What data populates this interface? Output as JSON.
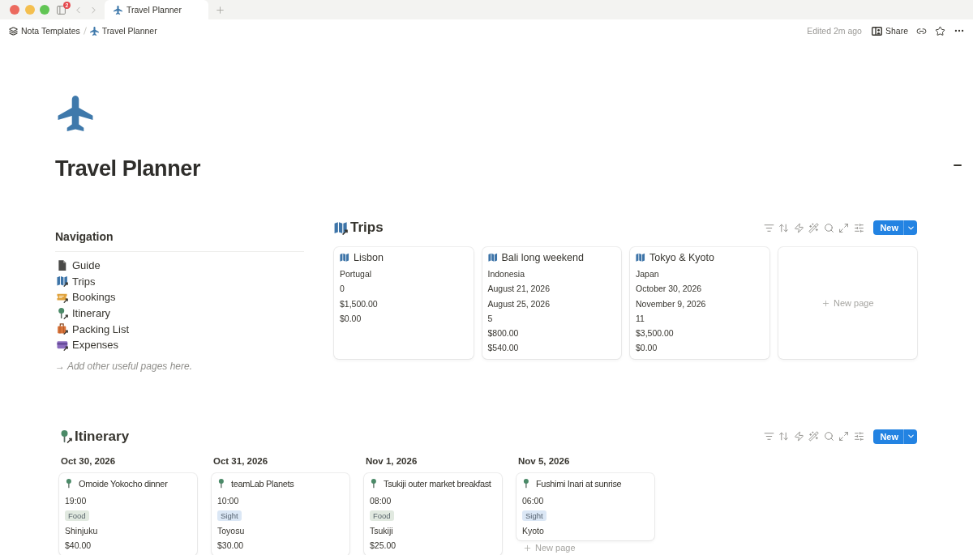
{
  "window": {
    "tabs": [
      {
        "title": "Travel Planner",
        "selected": true
      }
    ],
    "notification_count": "2"
  },
  "breadcrumb": [
    {
      "label": "Nota Templates",
      "kind": "workspace"
    },
    {
      "label": "Travel Planner",
      "kind": "page"
    }
  ],
  "page_header": {
    "edited": "Edited 2m ago",
    "share": "Share"
  },
  "page": {
    "title": "Travel Planner"
  },
  "navigation": {
    "heading": "Navigation",
    "items": [
      {
        "label": "Guide",
        "kind": "document",
        "linked": false
      },
      {
        "label": "Trips",
        "kind": "map",
        "linked": true
      },
      {
        "label": "Bookings",
        "kind": "ticket",
        "linked": true
      },
      {
        "label": "Itinerary",
        "kind": "pin",
        "linked": true
      },
      {
        "label": "Packing List",
        "kind": "luggage",
        "linked": true
      },
      {
        "label": "Expenses",
        "kind": "card",
        "linked": true
      }
    ],
    "hint": "→ Add other useful pages here."
  },
  "trips": {
    "title": "Trips",
    "new_button": "New",
    "cards": [
      {
        "title": "Lisbon",
        "properties": [
          "Portugal",
          "0",
          "$1,500.00",
          "$0.00"
        ]
      },
      {
        "title": "Bali long weekend",
        "properties": [
          "Indonesia",
          "August 21, 2026",
          "August 25, 2026",
          "5",
          "$800.00",
          "$540.00"
        ]
      },
      {
        "title": "Tokyo & Kyoto",
        "properties": [
          "Japan",
          "October 30, 2026",
          "November 9, 2026",
          "11",
          "$3,500.00",
          "$0.00"
        ]
      }
    ],
    "new_page": "New page"
  },
  "itinerary": {
    "title": "Itinerary",
    "new_button": "New",
    "groups": [
      {
        "date": "Oct 30, 2026",
        "cards": [
          {
            "title": "Omoide Yokocho dinner",
            "time": "19:00",
            "tag": {
              "label": "Food",
              "color": "#e1e9e0"
            },
            "location": "Shinjuku",
            "cost": "$40.00"
          }
        ]
      },
      {
        "date": "Oct 31, 2026",
        "cards": [
          {
            "title": "teamLab Planets",
            "time": "10:00",
            "tag": {
              "label": "Sight",
              "color": "#dbe7f5"
            },
            "location": "Toyosu",
            "cost": "$30.00"
          }
        ]
      },
      {
        "date": "Nov 1, 2026",
        "cards": [
          {
            "title": "Tsukiji outer market breakfast",
            "time": "08:00",
            "tag": {
              "label": "Food",
              "color": "#e1e9e0"
            },
            "location": "Tsukiji",
            "cost": "$25.00"
          }
        ]
      },
      {
        "date": "Nov 5, 2026",
        "cards": [
          {
            "title": "Fushimi Inari at sunrise",
            "time": "06:00",
            "tag": {
              "label": "Sight",
              "color": "#dbe7f5"
            },
            "location": "Kyoto"
          }
        ],
        "new_page": "New page"
      }
    ]
  }
}
